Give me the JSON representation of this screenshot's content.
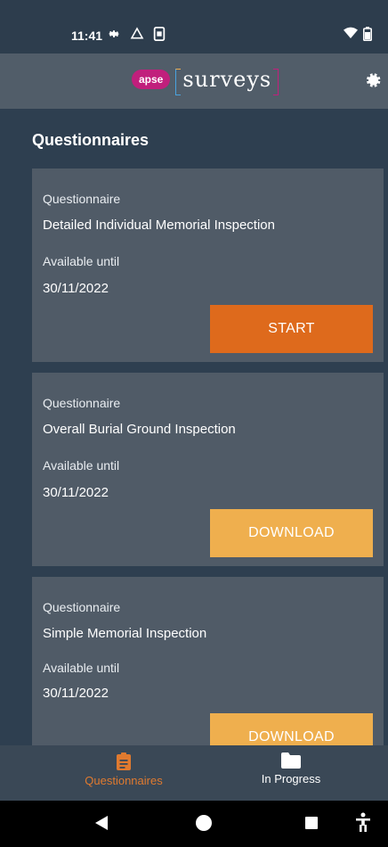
{
  "status_bar": {
    "time": "11:41",
    "left_icons": [
      "gear-icon",
      "drive-icon",
      "sim-icon"
    ],
    "right_icons": [
      "wifi-icon",
      "battery-icon"
    ]
  },
  "app_bar": {
    "logo_badge": "apse",
    "logo_text": "surveys",
    "settings_icon": "gear-icon"
  },
  "page": {
    "title": "Questionnaires"
  },
  "cards": [
    {
      "type_label": "Questionnaire",
      "name": "Detailed Individual Memorial Inspection",
      "available_label": "Available until",
      "date": "30/11/2022",
      "action_label": "START"
    },
    {
      "type_label": "Questionnaire",
      "name": "Overall Burial Ground Inspection",
      "available_label": "Available until",
      "date": "30/11/2022",
      "action_label": "DOWNLOAD"
    },
    {
      "type_label": "Questionnaire",
      "name": "Simple Memorial Inspection",
      "available_label": "Available until",
      "date": "30/11/2022",
      "action_label": "DOWNLOAD"
    }
  ],
  "bottom_nav": {
    "items": [
      {
        "label": "Questionnaires",
        "icon": "clipboard-icon",
        "active": true
      },
      {
        "label": "In Progress",
        "icon": "folder-icon",
        "active": false
      }
    ]
  },
  "system_nav": {
    "icons": [
      "back-icon",
      "home-icon",
      "recents-icon",
      "accessibility-icon"
    ]
  },
  "colors": {
    "background": "#2e3f50",
    "card": "#505b67",
    "start_button": "#de6a1c",
    "download_button": "#efaf4e",
    "active_nav": "#e07a2f",
    "brand_magenta": "#c11f7c"
  }
}
